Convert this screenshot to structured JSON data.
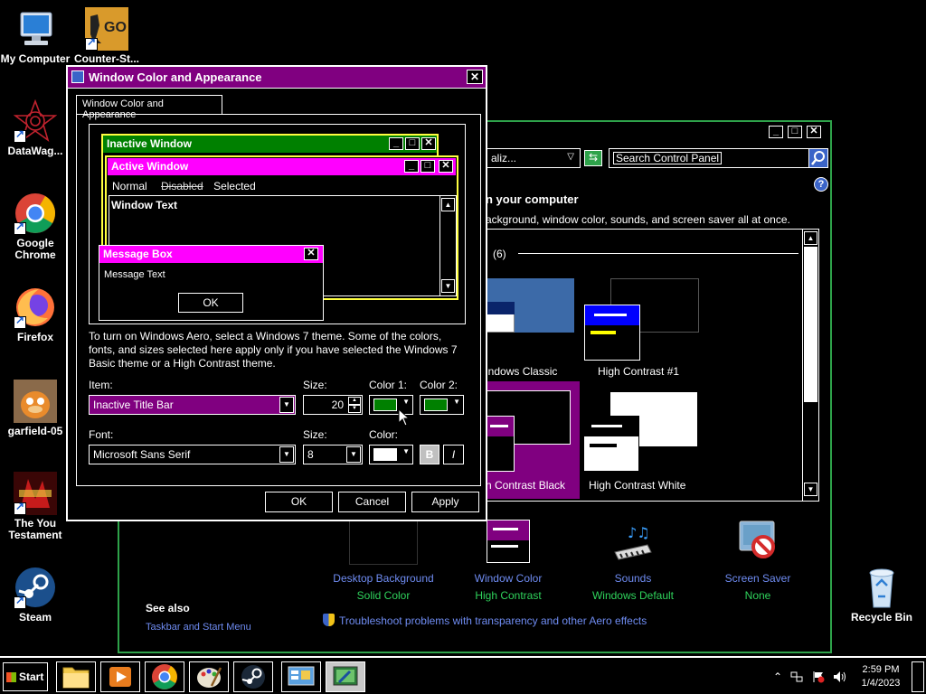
{
  "desktop": {
    "icons": [
      {
        "label": "My Computer"
      },
      {
        "label": "Counter-St..."
      },
      {
        "label": "DataWag..."
      },
      {
        "label": "Google Chrome"
      },
      {
        "label": "Firefox"
      },
      {
        "label": "garfield-05"
      },
      {
        "label": "The You Testament"
      },
      {
        "label": "Steam"
      },
      {
        "label": "Recycle Bin"
      }
    ],
    "csgo_logo_text": "GO"
  },
  "control_panel": {
    "address_text": "aliz...",
    "search_placeholder": "Search Control Panel",
    "help": "?",
    "heading": "n your computer",
    "description": "ackground, window color, sounds, and screen saver all at once.",
    "group_label": "(6)",
    "themes": [
      {
        "label": "indows Classic"
      },
      {
        "label": "High Contrast #1"
      },
      {
        "label": "n Contrast Black"
      },
      {
        "label": "High Contrast White"
      }
    ],
    "bottom_items": [
      {
        "title": "Desktop Background",
        "subtitle": "Solid Color"
      },
      {
        "title": "Window Color",
        "subtitle": "High Contrast"
      },
      {
        "title": "Sounds",
        "subtitle": "Windows Default"
      },
      {
        "title": "Screen Saver",
        "subtitle": "None"
      }
    ],
    "see_also": "See also",
    "see_also_link": "Taskbar and Start Menu",
    "troubleshoot": "Troubleshoot problems with transparency and other Aero effects"
  },
  "dialog": {
    "title": "Window Color and Appearance",
    "tab": "Window Color and Appearance",
    "preview": {
      "inactive_title": "Inactive Window",
      "active_title": "Active Window",
      "menu_normal": "Normal",
      "menu_disabled": "Disabled",
      "menu_selected": "Selected",
      "window_text": "Window Text",
      "message_box_title": "Message Box",
      "message_text": "Message Text",
      "ok": "OK"
    },
    "info": "To turn on Windows Aero, select a Windows 7 theme.  Some of the colors, fonts, and sizes selected here apply only if you have selected the Windows 7 Basic theme or a High Contrast theme.",
    "item_label": "Item:",
    "item_value": "Inactive Title Bar",
    "size_label": "Size:",
    "size_value": "20",
    "color1_label": "Color 1:",
    "color2_label": "Color 2:",
    "font_label": "Font:",
    "font_value": "Microsoft Sans Serif",
    "font_size_label": "Size:",
    "font_size_value": "8",
    "font_color_label": "Color:",
    "bold": "B",
    "italic": "I",
    "ok": "OK",
    "cancel": "Cancel",
    "apply": "Apply"
  },
  "taskbar": {
    "start": "Start",
    "time": "2:59 PM",
    "date": "1/4/2023"
  },
  "colors": {
    "inactive_title": "#008000",
    "active_title": "#ff00ff",
    "dialog_title": "#800080",
    "cp_border": "#2ea24a",
    "link": "#6f8cf2",
    "subtitle_green": "#2fd35c",
    "color1": "#008000",
    "color2": "#008000",
    "font_color": "#ffffff"
  }
}
